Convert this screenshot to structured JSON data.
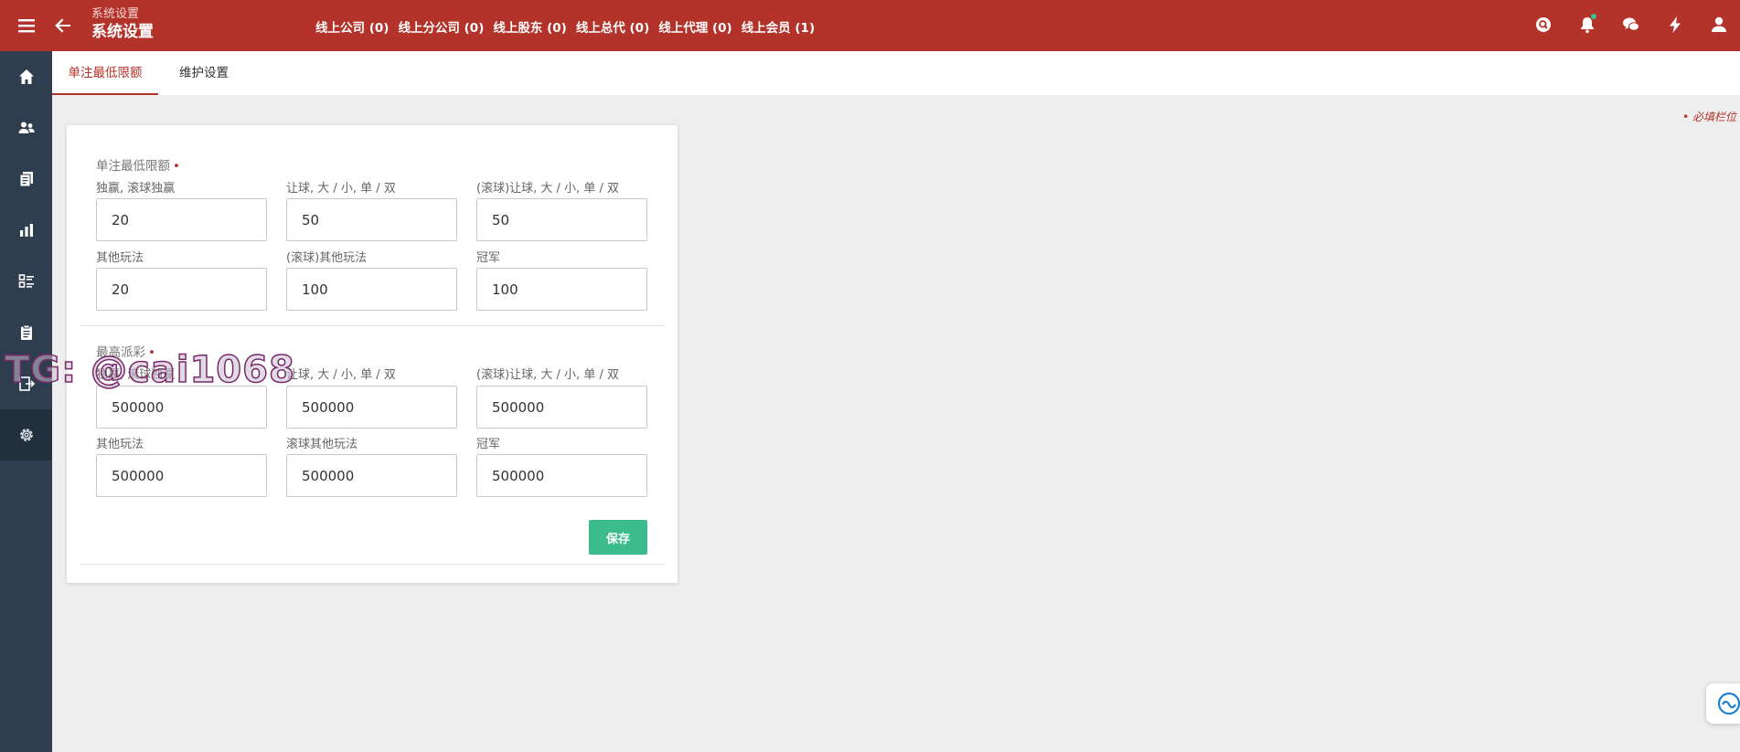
{
  "header": {
    "breadcrumb": "系统设置",
    "title": "系统设置",
    "stats": [
      "线上公司 (0)",
      "线上分公司 (0)",
      "线上股东 (0)",
      "线上总代 (0)",
      "线上代理 (0)",
      "线上会员 (1)"
    ],
    "icons": [
      "search-icon",
      "bell-icon",
      "chat-icon",
      "lightning-icon",
      "user-icon"
    ]
  },
  "sidebar": {
    "items": [
      "home-icon",
      "users-icon",
      "documents-icon",
      "chart-icon",
      "list-icon",
      "clipboard-icon",
      "export-icon",
      "gear-icon"
    ],
    "active_index": 7
  },
  "tabs": [
    "单注最低限额",
    "维护设置"
  ],
  "active_tab": 0,
  "required_note": "• 必填栏位",
  "form": {
    "min_bet": {
      "title": "单注最低限额",
      "required_mark": "•",
      "fields": [
        {
          "label": "独赢, 滚球独赢",
          "value": "20"
        },
        {
          "label": "让球, 大 / 小, 单 / 双",
          "value": "50"
        },
        {
          "label": "(滚球)让球, 大 / 小, 单 / 双",
          "value": "50"
        },
        {
          "label": "其他玩法",
          "value": "20"
        },
        {
          "label": "(滚球)其他玩法",
          "value": "100"
        },
        {
          "label": "冠军",
          "value": "100"
        }
      ]
    },
    "max_payout": {
      "title": "最高派彩",
      "required_mark": "•",
      "fields": [
        {
          "label": "独赢, 滚球独赢",
          "value": "500000"
        },
        {
          "label": "让球, 大 / 小, 单 / 双",
          "value": "500000"
        },
        {
          "label": "(滚球)让球, 大 / 小, 单 / 双",
          "value": "500000"
        },
        {
          "label": "其他玩法",
          "value": "500000"
        },
        {
          "label": "滚球其他玩法",
          "value": "500000"
        },
        {
          "label": "冠军",
          "value": "500000"
        }
      ]
    },
    "save_label": "保存"
  },
  "watermark": "TG: @cai1068"
}
